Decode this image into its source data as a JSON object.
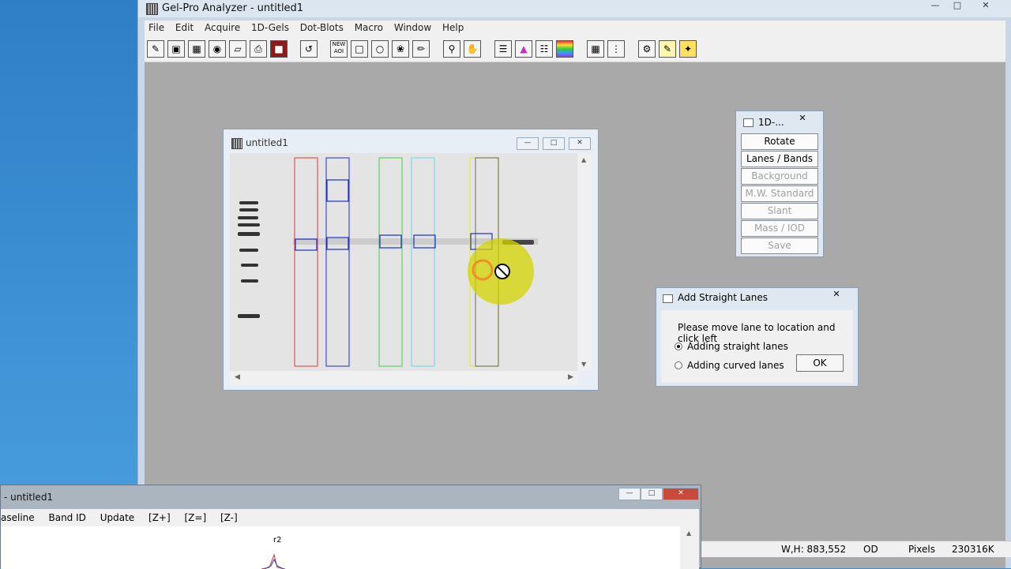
{
  "app": {
    "title": "Gel-Pro Analyzer - untitled1",
    "window_buttons": {
      "minimize": "—",
      "maximize": "□",
      "close": "✕"
    }
  },
  "menu": [
    "File",
    "Edit",
    "Acquire",
    "1D-Gels",
    "Dot-Blots",
    "Macro",
    "Window",
    "Help"
  ],
  "toolbar": {
    "new_aoi_label": "NEW AOI",
    "icons": [
      "open-icon",
      "save-icon",
      "grid-icon",
      "camera-icon",
      "eraser-icon",
      "print-icon",
      "book-icon",
      "undo-icon",
      "new-aoi-icon",
      "rectangle-icon",
      "ellipse-icon",
      "freehand-icon",
      "pencil-icon",
      "zoom-icon",
      "hand-icon",
      "lane-tool-icon",
      "peak-icon",
      "bands-icon",
      "color-palette-icon",
      "grid-view-icon",
      "dots-icon",
      "settings-icon",
      "script-icon",
      "wand-icon"
    ]
  },
  "image_window": {
    "title": "untitled1"
  },
  "panel_1d": {
    "title": "1D-...",
    "buttons": [
      {
        "label": "Rotate",
        "enabled": true
      },
      {
        "label": "Lanes / Bands",
        "enabled": true
      },
      {
        "label": "Background",
        "enabled": false
      },
      {
        "label": "M.W. Standard",
        "enabled": false
      },
      {
        "label": "Slant",
        "enabled": false
      },
      {
        "label": "Mass / IOD",
        "enabled": false
      },
      {
        "label": "Save",
        "enabled": false
      }
    ]
  },
  "dialog": {
    "title": "Add Straight Lanes",
    "message": "Please move lane to location and click left",
    "option_straight": "Adding straight lanes",
    "option_curved": "Adding curved lanes",
    "ok_label": "OK",
    "selected": "straight"
  },
  "bottom_window": {
    "title": "- untitled1",
    "menu": [
      "aseline",
      "Band ID",
      "Update",
      "[Z+]",
      "[Z=]",
      "[Z-]"
    ],
    "peak_label": "r2"
  },
  "status": {
    "wh": "W,H: 883,552",
    "mode": "OD",
    "units": "Pixels",
    "memory": "230316K"
  },
  "colors": {
    "lane_red": "#e53935",
    "lane_blue": "#1e2ec8",
    "lane_green": "#43d043",
    "lane_cyan": "#5fd8e8",
    "lane_yellow": "#e8e830"
  }
}
